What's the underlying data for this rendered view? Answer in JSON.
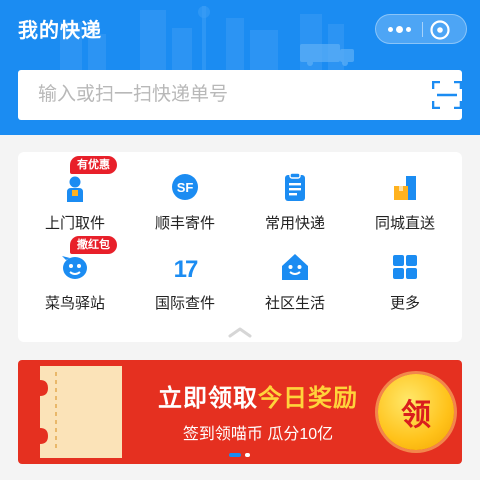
{
  "header": {
    "title": "我的快递",
    "menu_icon": "more-dots-icon",
    "close_icon": "close-target-icon",
    "bg_color": "#1b8cf2"
  },
  "search": {
    "placeholder": "输入或扫一扫快递单号",
    "scan_icon": "scan-icon"
  },
  "services": [
    {
      "label": "上门取件",
      "icon": "courier-person-icon",
      "badge": "有优惠"
    },
    {
      "label": "顺丰寄件",
      "icon": "sf-express-icon",
      "badge": ""
    },
    {
      "label": "常用快递",
      "icon": "clipboard-list-icon",
      "badge": ""
    },
    {
      "label": "同城直送",
      "icon": "package-stack-icon",
      "badge": ""
    },
    {
      "label": "菜鸟驿站",
      "icon": "cainiao-bird-icon",
      "badge": "撒红包"
    },
    {
      "label": "国际查件",
      "icon": "seventeen-icon",
      "badge": ""
    },
    {
      "label": "社区生活",
      "icon": "house-smile-icon",
      "badge": ""
    },
    {
      "label": "更多",
      "icon": "grid-squares-icon",
      "badge": ""
    }
  ],
  "banner": {
    "line1_prefix": "立即领取",
    "line1_highlight": "今日奖励",
    "line2": "签到领喵币 瓜分10亿",
    "coin_label": "领",
    "bg_color": "#e53020",
    "highlight_color": "#ffd33b"
  },
  "pager": {
    "pages": 2,
    "active": 1
  }
}
